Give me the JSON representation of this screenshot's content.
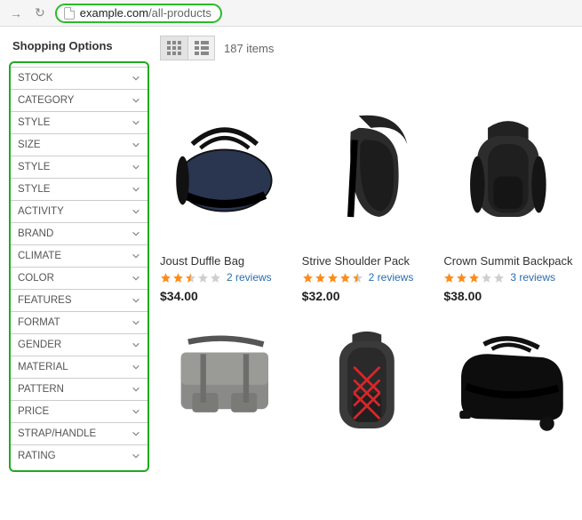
{
  "browser": {
    "url_pre": "example.com",
    "url_path": "/all-products"
  },
  "sidebar": {
    "title": "Shopping Options",
    "filters": [
      "STOCK",
      "CATEGORY",
      "STYLE",
      "SIZE",
      "STYLE",
      "STYLE",
      "ACTIVITY",
      "BRAND",
      "CLIMATE",
      "COLOR",
      "FEATURES",
      "FORMAT",
      "GENDER",
      "MATERIAL",
      "PATTERN",
      "PRICE",
      "STRAP/HANDLE",
      "RATING"
    ]
  },
  "toolbar": {
    "item_count": "187 items"
  },
  "colors": {
    "star_fill": "#ff8c1a",
    "star_empty": "#cfcfcf"
  },
  "products": [
    {
      "name": "Joust Duffle Bag",
      "rating": 2.5,
      "reviews": "2 reviews",
      "price": "$34.00"
    },
    {
      "name": "Strive Shoulder Pack",
      "rating": 4.5,
      "reviews": "2 reviews",
      "price": "$32.00"
    },
    {
      "name": "Crown Summit Backpack",
      "rating": 3.0,
      "reviews": "3 reviews",
      "price": "$38.00"
    },
    {
      "name": "",
      "rating": 0,
      "reviews": "",
      "price": ""
    },
    {
      "name": "",
      "rating": 0,
      "reviews": "",
      "price": ""
    },
    {
      "name": "",
      "rating": 0,
      "reviews": "",
      "price": ""
    }
  ]
}
